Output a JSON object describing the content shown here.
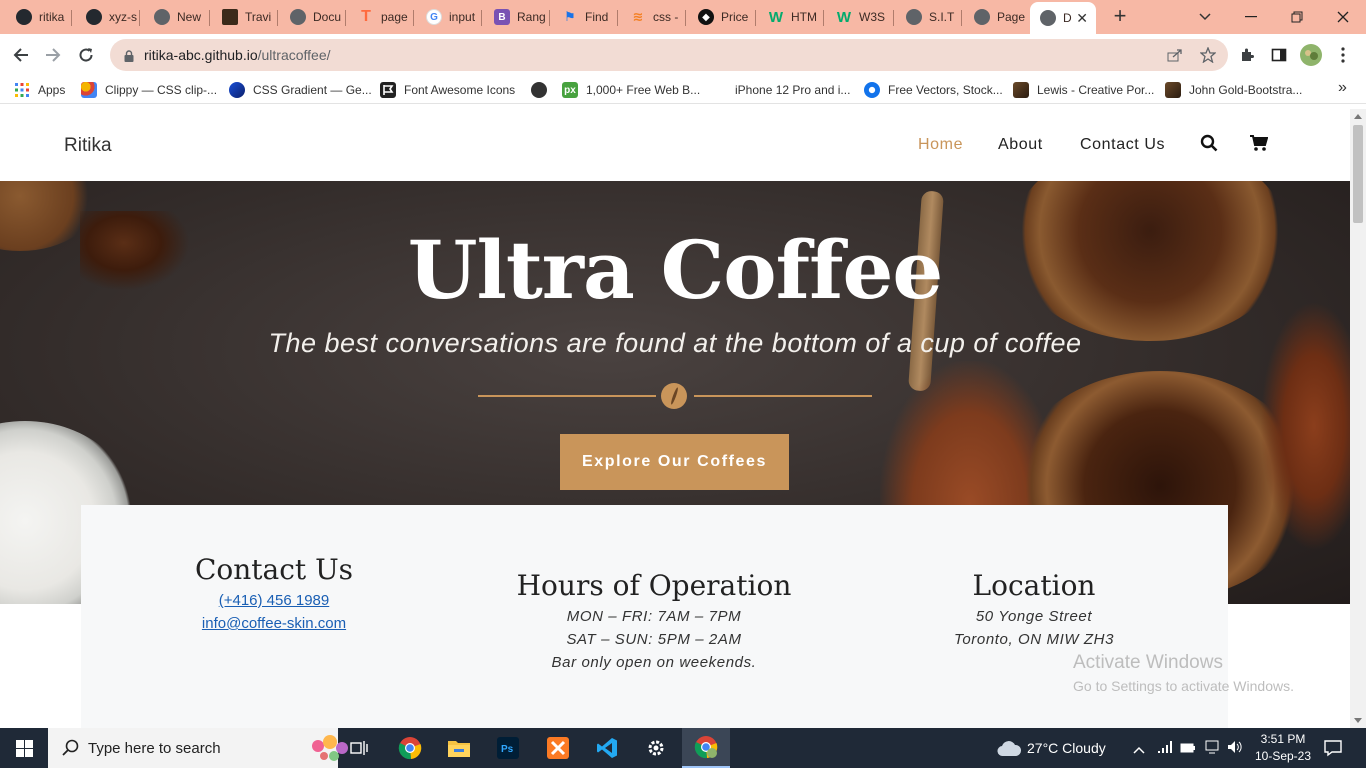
{
  "browser": {
    "tabs": [
      {
        "label": "ritika",
        "icon": "github-icon",
        "color": "#24292f"
      },
      {
        "label": "xyz-s",
        "icon": "github-icon",
        "color": "#24292f"
      },
      {
        "label": "New",
        "icon": "chrome-icon",
        "color": "#5f6368"
      },
      {
        "label": "Travi",
        "icon": "travis-icon",
        "color": "#3b2a1a"
      },
      {
        "label": "Docu",
        "icon": "globe-icon",
        "color": "#5f6368"
      },
      {
        "label": "page",
        "icon": "t-logo-icon",
        "color": "#ff6a3d"
      },
      {
        "label": "input",
        "icon": "google-icon",
        "color": "#4285f4"
      },
      {
        "label": "Rang",
        "icon": "bootstrap-icon",
        "color": "#7952b3"
      },
      {
        "label": "Find",
        "icon": "flag-icon",
        "color": "#1a73e8"
      },
      {
        "label": "css -",
        "icon": "stackoverflow-icon",
        "color": "#f48024"
      },
      {
        "label": "Price",
        "icon": "codepen-icon",
        "color": "#111111"
      },
      {
        "label": "HTM",
        "icon": "w3-icon",
        "color": "#04aa6d"
      },
      {
        "label": "W3S",
        "icon": "w3-icon",
        "color": "#04aa6d"
      },
      {
        "label": "S.I.T",
        "icon": "globe-icon",
        "color": "#5f6368"
      },
      {
        "label": "Page",
        "icon": "globe-icon",
        "color": "#5f6368"
      },
      {
        "label": "D",
        "icon": "globe-icon",
        "color": "#5f6368",
        "active": true
      }
    ],
    "new_tab": "+",
    "url_host": "ritika-abc.github.io",
    "url_path": "/ultracoffee/",
    "bookmarks": [
      {
        "label": "Apps",
        "icon": "apps-grid-icon",
        "color": "#4285f4"
      },
      {
        "label": "Clippy — CSS clip-...",
        "icon": "clippy-icon",
        "color": "#f4b400"
      },
      {
        "label": "CSS Gradient — Ge...",
        "icon": "css-gradient-icon",
        "color": "#1a4fd8"
      },
      {
        "label": "Font Awesome Icons",
        "icon": "font-awesome-icon",
        "color": "#222222"
      },
      {
        "label": "",
        "icon": "globe-icon",
        "color": "#333333"
      },
      {
        "label": "1,000+ Free Web B...",
        "icon": "pixabay-icon",
        "color": "#48a23f"
      },
      {
        "label": "iPhone 12 Pro and i...",
        "icon": "apple-icon",
        "color": "#222222"
      },
      {
        "label": "Free Vectors, Stock...",
        "icon": "freepik-icon",
        "color": "#1273eb"
      },
      {
        "label": "Lewis - Creative Por...",
        "icon": "portfolio-icon",
        "color": "#3b2a1a"
      },
      {
        "label": "John Gold-Bootstra...",
        "icon": "portfolio-icon",
        "color": "#3b2a1a"
      }
    ],
    "more_bookmarks": "»"
  },
  "site": {
    "brand": "Ritika",
    "nav": [
      {
        "label": "Home",
        "active": true
      },
      {
        "label": "About",
        "active": false
      },
      {
        "label": "Contact Us",
        "active": false
      }
    ],
    "accent_color": "#c9955a",
    "hero": {
      "title": "Ultra Coffee",
      "subtitle": "The best conversations are found at the bottom of a cup of coffee",
      "cta": "Explore Our Coffees"
    },
    "info": {
      "contact": {
        "title": "Contact Us",
        "phone": "(+416) 456 1989",
        "email": "info@coffee-skin.com"
      },
      "hours": {
        "title": "Hours of Operation",
        "lines": [
          "MON – FRI: 7AM – 7PM",
          "SAT – SUN: 5PM – 2AM",
          "Bar only open on weekends."
        ]
      },
      "location": {
        "title": "Location",
        "lines": [
          "50 Yonge Street",
          "Toronto, ON MIW ZH3"
        ]
      }
    }
  },
  "watermark": {
    "line1": "Activate Windows",
    "line2": "Go to Settings to activate Windows."
  },
  "taskbar": {
    "search_placeholder": "Type here to search",
    "apps": [
      {
        "name": "task-view-icon"
      },
      {
        "name": "chrome-icon"
      },
      {
        "name": "file-explorer-icon"
      },
      {
        "name": "photoshop-icon"
      },
      {
        "name": "xampp-icon"
      },
      {
        "name": "vscode-icon"
      },
      {
        "name": "settings-icon"
      },
      {
        "name": "chrome-profile-icon",
        "active": true
      }
    ],
    "weather": "27°C  Cloudy",
    "time": "3:51 PM",
    "date": "10-Sep-23"
  }
}
